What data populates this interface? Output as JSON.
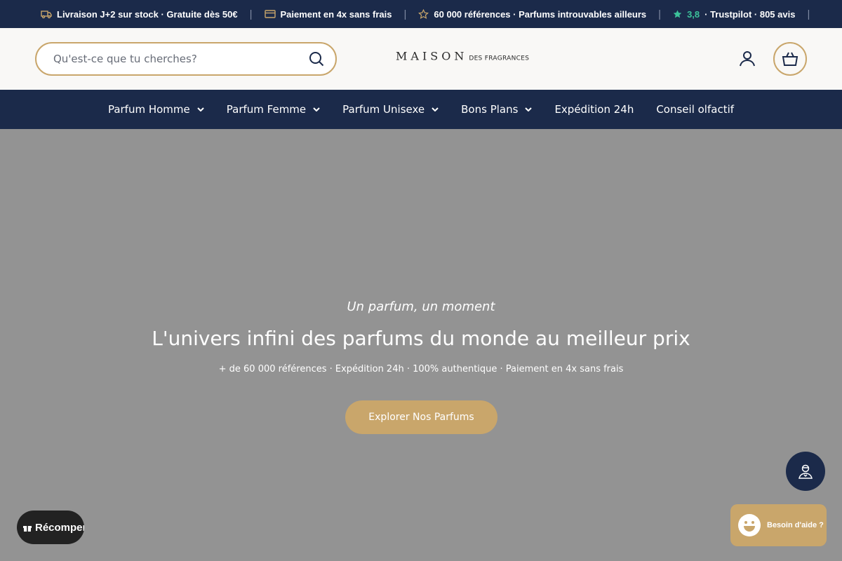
{
  "announcement": {
    "items": [
      {
        "text": "Livraison J+2 sur stock · Gratuite dès 50€",
        "icon": "truck-icon"
      },
      {
        "text": "Paiement en 4x sans frais",
        "icon": "credit-card-icon"
      },
      {
        "text": "60 000 références · Parfums introuvables ailleurs",
        "icon": "star-outline-icon"
      }
    ],
    "rating_value": "3,8",
    "rating_text": "· Trustpilot · 805 avis",
    "separator": "|",
    "colors": {
      "background": "#1b2a4a",
      "rating": "#3cc29a"
    }
  },
  "header": {
    "search_placeholder": "Qu'est-ce que tu cherches?",
    "logo_main": "MAISON",
    "logo_sub": "DES FRAGRANCES",
    "account_icon": "user-icon",
    "cart_icon": "basket-icon",
    "accent": "#c9a66b"
  },
  "nav": {
    "items": [
      {
        "label": "Parfum Homme",
        "has_dropdown": true
      },
      {
        "label": "Parfum Femme",
        "has_dropdown": true
      },
      {
        "label": "Parfum Unisexe",
        "has_dropdown": true
      },
      {
        "label": "Bons Plans",
        "has_dropdown": true
      },
      {
        "label": "Expédition 24h",
        "has_dropdown": false
      },
      {
        "label": "Conseil olfactif",
        "has_dropdown": false
      }
    ]
  },
  "hero": {
    "tagline": "Un parfum, un moment",
    "headline": "L'univers infini des parfums du monde au meilleur prix",
    "subline": "+ de 60 000 références · Expédition 24h · 100% authentique · Paiement en 4x sans frais",
    "cta": "Explorer Nos Parfums"
  },
  "widgets": {
    "rewards_label": "Récompenses",
    "help_label": "Besoin d'aide ?",
    "assistant_icon": "advisor-icon"
  }
}
